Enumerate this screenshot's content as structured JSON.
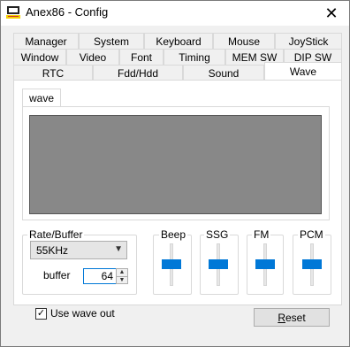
{
  "window": {
    "title": "Anex86 - Config",
    "close_glyph": "✕"
  },
  "tabs": {
    "row1": [
      "Manager",
      "System",
      "Keyboard",
      "Mouse",
      "JoyStick"
    ],
    "row2": [
      "Window",
      "Video",
      "Font",
      "Timing",
      "MEM SW",
      "DIP SW"
    ],
    "row3": [
      "RTC",
      "Fdd/Hdd",
      "Sound",
      "Wave"
    ],
    "active": "Wave"
  },
  "wave_panel": {
    "label": "wave",
    "display_color": "#888888"
  },
  "rate_buffer": {
    "label": "Rate/Buffer",
    "rate_selected": "55KHz",
    "buffer_label": "buffer",
    "buffer_value": "64"
  },
  "sliders": [
    {
      "label": "Beep",
      "level": 0.5
    },
    {
      "label": "SSG",
      "level": 0.5
    },
    {
      "label": "FM",
      "level": 0.5
    },
    {
      "label": "PCM",
      "level": 0.5
    }
  ],
  "options": {
    "use_wave_out_label": "Use wave out",
    "use_wave_out_checked": true
  },
  "buttons": {
    "reset_label": "Reset"
  },
  "colors": {
    "accent": "#0078d7"
  }
}
